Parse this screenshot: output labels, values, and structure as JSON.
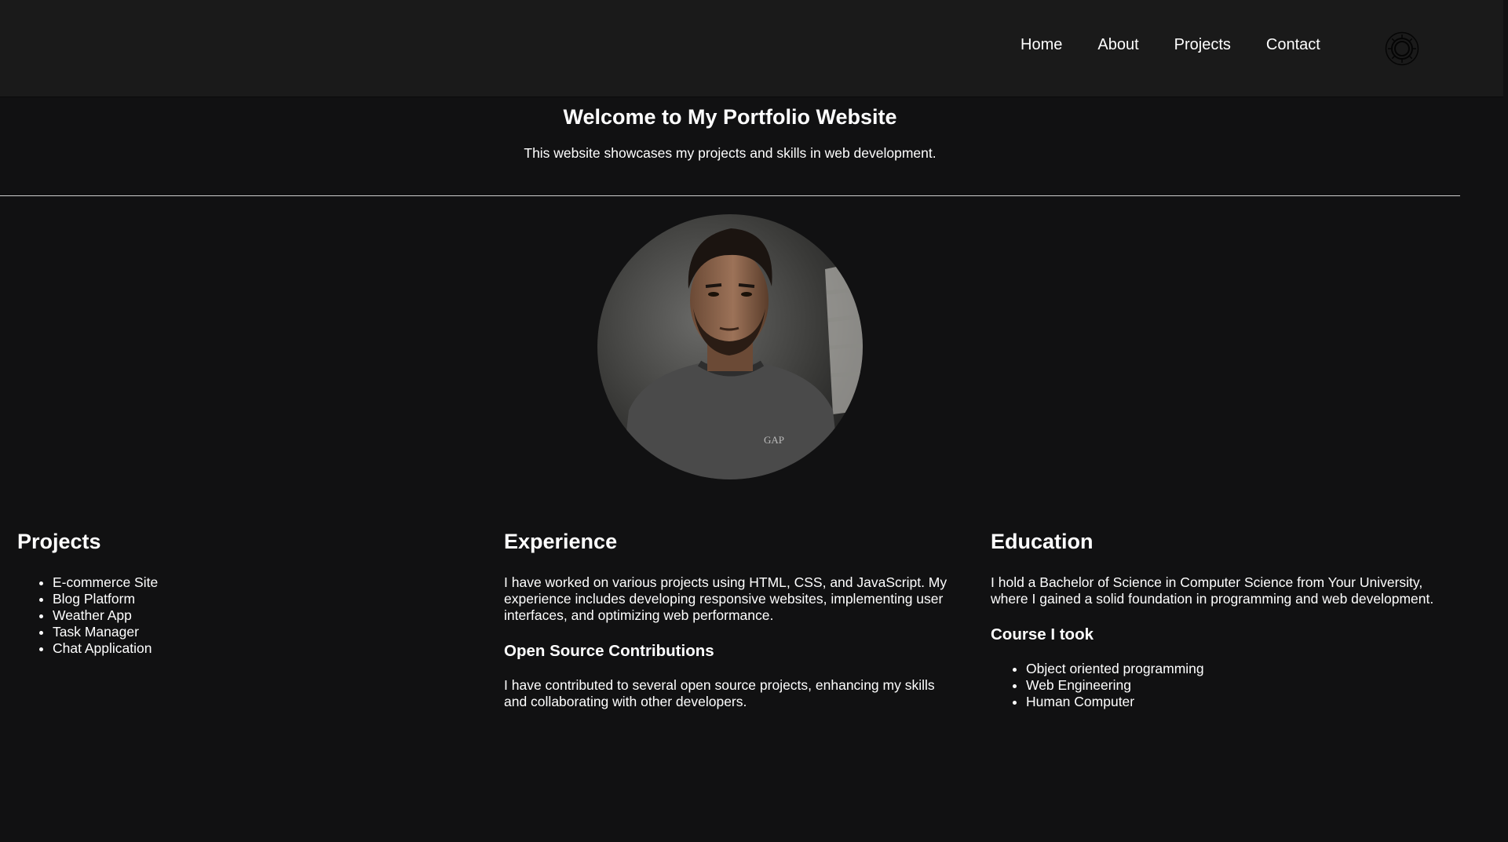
{
  "header": {
    "nav": [
      {
        "label": "Home"
      },
      {
        "label": "About"
      },
      {
        "label": "Projects"
      },
      {
        "label": "Contact"
      }
    ],
    "theme_toggle_icon": "sun-icon"
  },
  "hero": {
    "title": "Welcome to My Portfolio Website",
    "subtitle": "This website showcases my projects and skills in web development."
  },
  "profile": {
    "photo_icon": "profile-photo"
  },
  "projects": {
    "heading": "Projects",
    "items": [
      "E-commerce Site",
      "Blog Platform",
      "Weather App",
      "Task Manager",
      "Chat Application"
    ]
  },
  "experience": {
    "heading": "Experience",
    "body": "I have worked on various projects using HTML, CSS, and JavaScript. My experience includes developing responsive websites, implementing user interfaces, and optimizing web performance.",
    "subheading": "Open Source Contributions",
    "sub_body": "I have contributed to several open source projects, enhancing my skills and collaborating with other developers."
  },
  "education": {
    "heading": "Education",
    "body": "I hold a Bachelor of Science in Computer Science from Your University, where I gained a solid foundation in programming and web development.",
    "subheading": "Course I took",
    "courses": [
      "Object oriented programming",
      "Web Engineering",
      "Human Computer"
    ]
  },
  "colors": {
    "background": "#111112",
    "header": "#1a1a1a",
    "text": "#ffffff"
  }
}
